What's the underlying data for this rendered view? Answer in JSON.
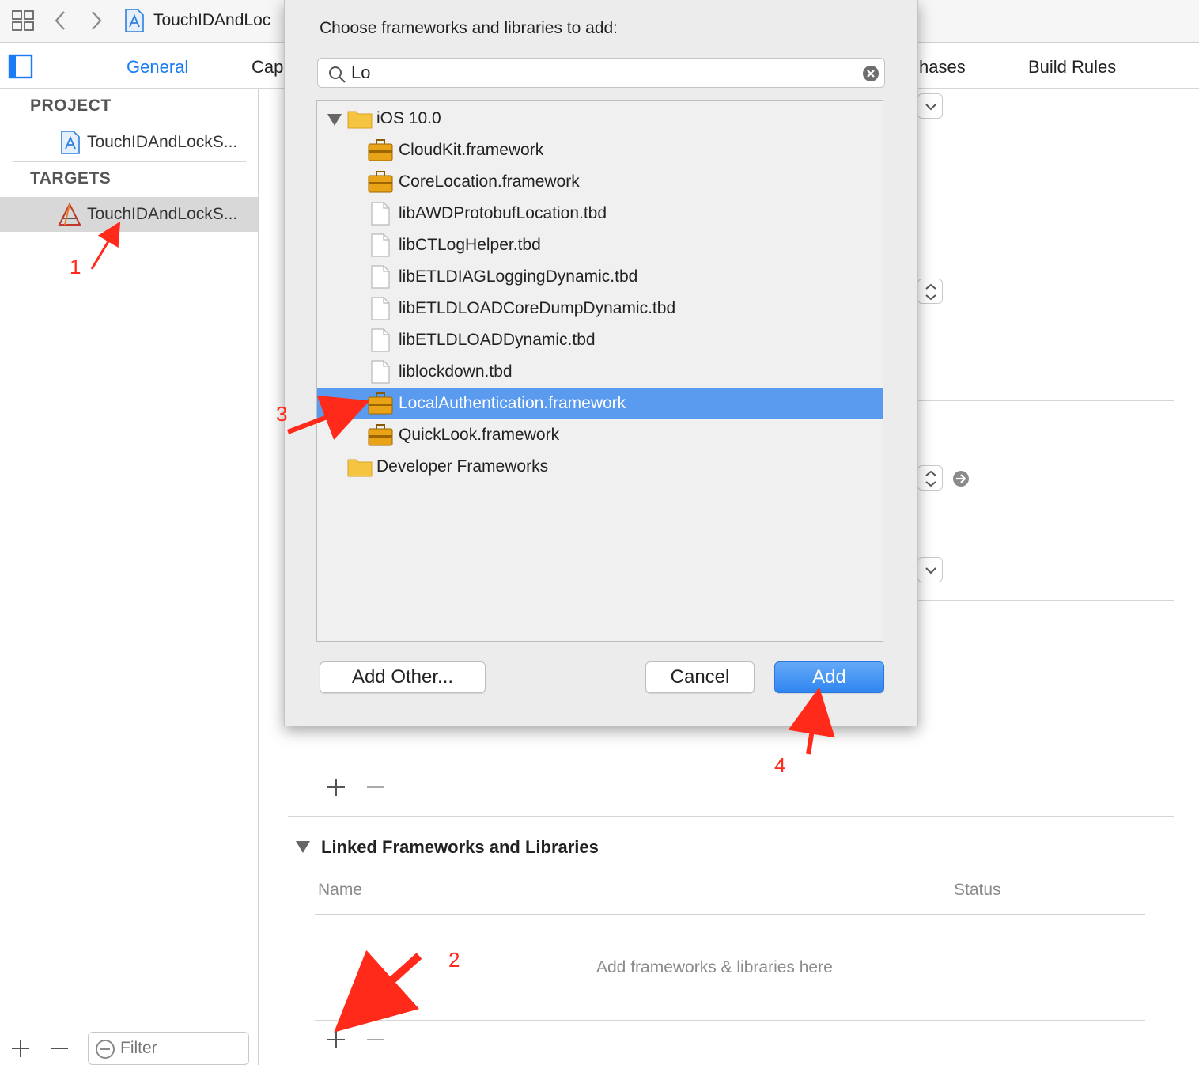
{
  "toolbar": {
    "title": "TouchIDAndLoc"
  },
  "tabs": {
    "general": "General",
    "capabilities": "Cap",
    "build_phases": "hases",
    "build_rules": "Build Rules"
  },
  "sidebar": {
    "project_header": "PROJECT",
    "project_item": "TouchIDAndLockS...",
    "targets_header": "TARGETS",
    "target_item": "TouchIDAndLockS...",
    "filter_placeholder": "Filter"
  },
  "dialog": {
    "title": "Choose frameworks and libraries to add:",
    "search_value": "Lo",
    "folder_ios": "iOS 10.0",
    "items": [
      "CloudKit.framework",
      "CoreLocation.framework",
      "libAWDProtobufLocation.tbd",
      "libCTLogHelper.tbd",
      "libETLDIAGLoggingDynamic.tbd",
      "libETLDLOADCoreDumpDynamic.tbd",
      "libETLDLOADDynamic.tbd",
      "liblockdown.tbd",
      "LocalAuthentication.framework",
      "QuickLook.framework"
    ],
    "folder_developer": "Developer Frameworks",
    "add_other_label": "Add Other...",
    "cancel_label": "Cancel",
    "add_label": "Add"
  },
  "linked": {
    "title": "Linked Frameworks and Libraries",
    "col_name": "Name",
    "col_status": "Status",
    "empty_text": "Add frameworks & libraries here"
  },
  "annotations": {
    "step1": "1",
    "step2": "2",
    "step3": "3",
    "step4": "4"
  },
  "colors": {
    "accent": "#1a7cf5",
    "selection": "#5a9bf0",
    "annotation": "#ff2a1a"
  }
}
